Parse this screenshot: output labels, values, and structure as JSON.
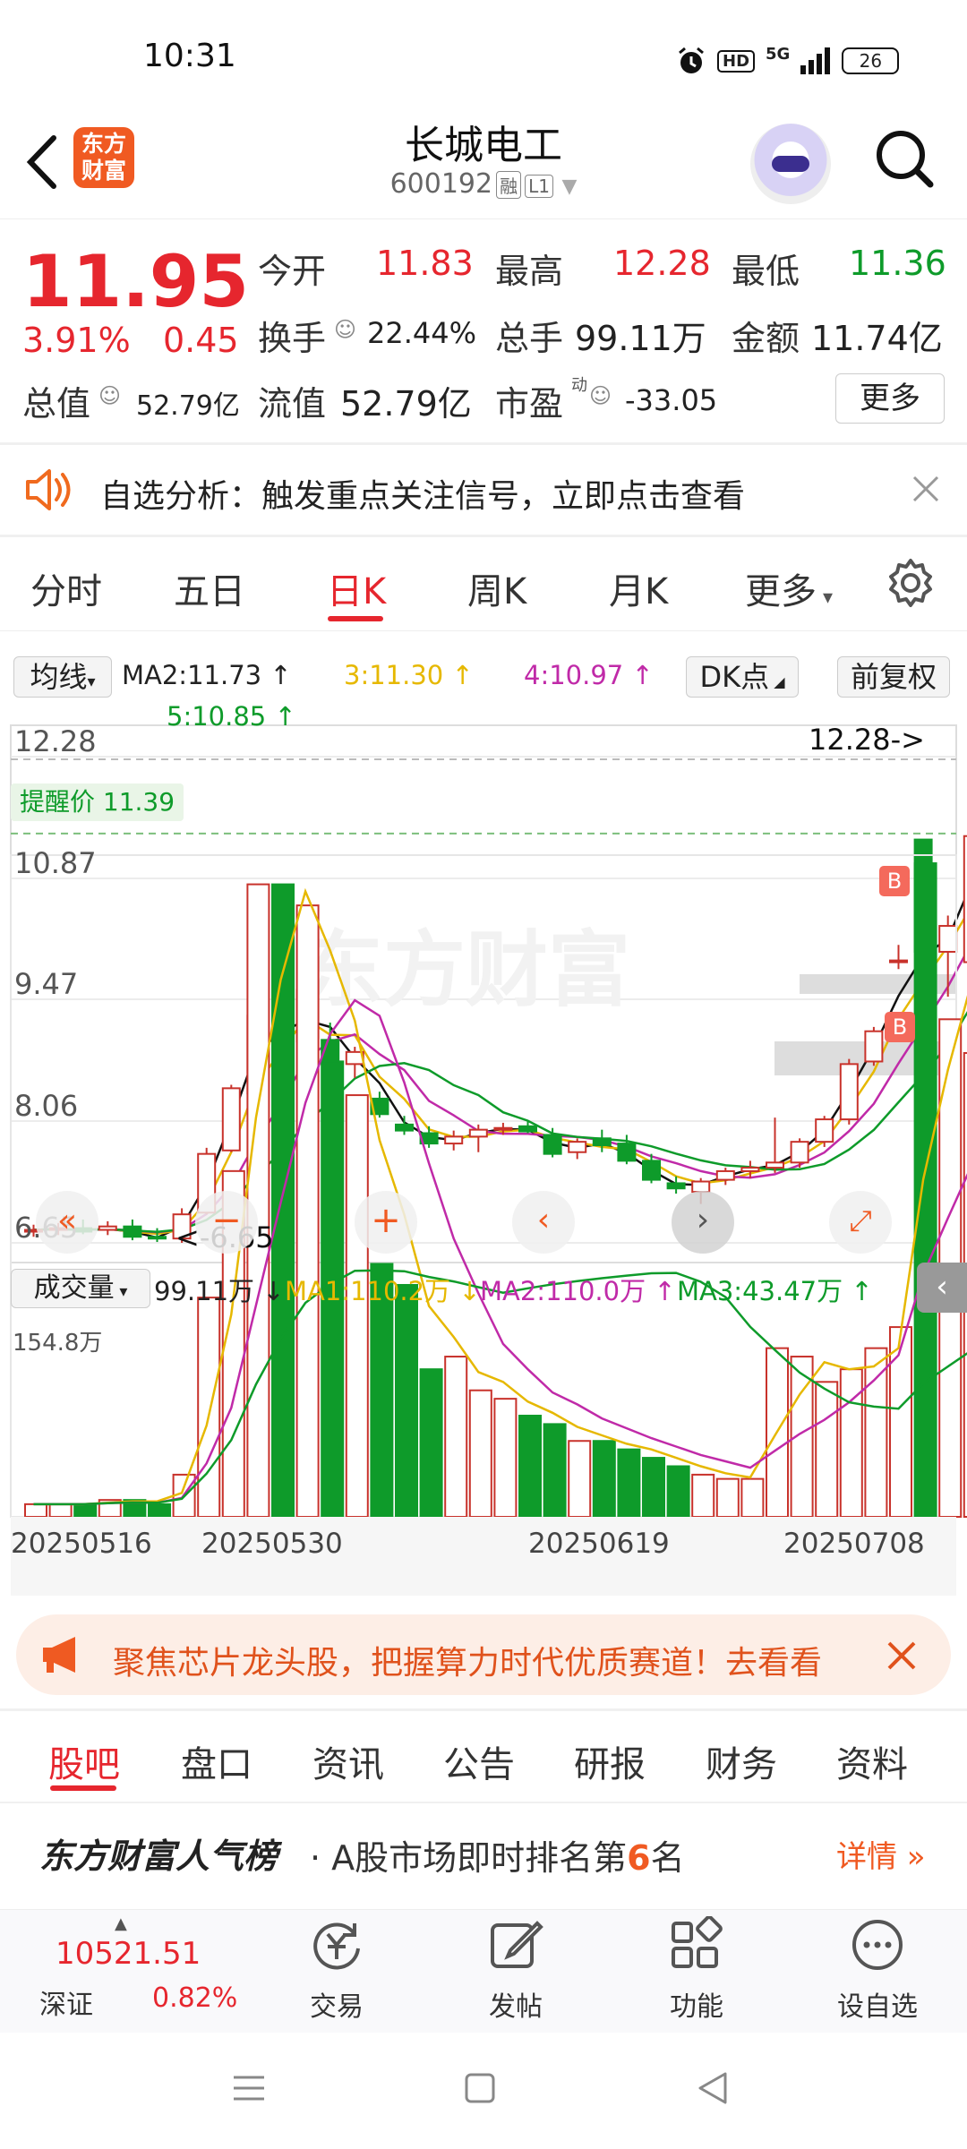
{
  "status": {
    "time": "10:31",
    "network": "5G",
    "hd": "HD",
    "battery": "26"
  },
  "header": {
    "logo_line1": "东方",
    "logo_line2": "财富",
    "title": "长城电工",
    "code": "600192",
    "tag1": "融",
    "tag2": "L1"
  },
  "quote": {
    "price": "11.95",
    "pct": "3.91%",
    "change": "0.45",
    "open_label": "今开",
    "open": "11.83",
    "high_label": "最高",
    "high": "12.28",
    "low_label": "最低",
    "low": "11.36",
    "turnover_label": "换手",
    "turnover": "22.44%",
    "volume_label": "总手",
    "volume": "99.11万",
    "amount_label": "金额",
    "amount": "11.74亿",
    "mktcap_label": "总值",
    "mktcap": "52.79亿",
    "float_label": "流值",
    "float": "52.79亿",
    "pe_label": "市盈",
    "pe_sup": "动",
    "pe": "-33.05",
    "more": "更多"
  },
  "alert": {
    "text": "自选分析：触发重点关注信号，立即点击查看"
  },
  "tabs": [
    "分时",
    "五日",
    "日K",
    "周K",
    "月K",
    "更多"
  ],
  "active_tab": "日K",
  "chart_controls": {
    "ma_select": "均线",
    "ma2": "MA2:11.73",
    "ma3": "3:11.30",
    "ma4": "4:10.97",
    "ma5": "5:10.85",
    "dk": "DK点",
    "adjust": "前复权",
    "reminder": "提醒价 11.39",
    "high_marker": "12.28->",
    "low_marker": "<-6.65",
    "vol_select": "成交量",
    "vol_value": "99.11万",
    "vol_ma1": "MA1:110.2万",
    "vol_ma2": "MA2:110.0万",
    "vol_ma3": "MA3:43.47万",
    "vol_max": "154.8万",
    "watermark": "东方财富",
    "buy_mark": "B"
  },
  "chart_data": {
    "type": "candlestick",
    "price_axis_ticks": [
      "12.28",
      "10.87",
      "9.47",
      "8.06",
      "6.65"
    ],
    "ylim": [
      6.65,
      12.28
    ],
    "x_tick_labels": [
      "20250516",
      "20250530",
      "20250619",
      "20250708"
    ],
    "reminder_price": 11.39,
    "candles": [
      {
        "o": 6.78,
        "h": 6.86,
        "l": 6.72,
        "c": 6.8
      },
      {
        "o": 6.8,
        "h": 6.88,
        "l": 6.74,
        "c": 6.82
      },
      {
        "o": 6.82,
        "h": 6.92,
        "l": 6.75,
        "c": 6.78
      },
      {
        "o": 6.8,
        "h": 6.9,
        "l": 6.74,
        "c": 6.84
      },
      {
        "o": 6.84,
        "h": 6.92,
        "l": 6.68,
        "c": 6.72
      },
      {
        "o": 6.72,
        "h": 6.82,
        "l": 6.66,
        "c": 6.7
      },
      {
        "o": 6.7,
        "h": 7.05,
        "l": 6.65,
        "c": 6.98
      },
      {
        "o": 7.0,
        "h": 7.75,
        "l": 6.98,
        "c": 7.68
      },
      {
        "o": 7.72,
        "h": 8.48,
        "l": 7.7,
        "c": 8.44
      },
      {
        "o": 8.38,
        "h": 9.3,
        "l": 8.18,
        "c": 9.28
      },
      {
        "o": 9.3,
        "h": 9.5,
        "l": 8.85,
        "c": 8.88
      },
      {
        "o": 8.98,
        "h": 9.7,
        "l": 8.88,
        "c": 9.58
      },
      {
        "o": 9.0,
        "h": 9.2,
        "l": 8.6,
        "c": 8.72
      },
      {
        "o": 8.72,
        "h": 8.92,
        "l": 8.56,
        "c": 8.86
      },
      {
        "o": 8.32,
        "h": 8.4,
        "l": 8.1,
        "c": 8.14
      },
      {
        "o": 8.02,
        "h": 8.12,
        "l": 7.9,
        "c": 7.95
      },
      {
        "o": 7.92,
        "h": 8.0,
        "l": 7.75,
        "c": 7.8
      },
      {
        "o": 7.8,
        "h": 7.95,
        "l": 7.72,
        "c": 7.88
      },
      {
        "o": 7.88,
        "h": 8.02,
        "l": 7.7,
        "c": 7.96
      },
      {
        "o": 7.96,
        "h": 8.04,
        "l": 7.9,
        "c": 7.98
      },
      {
        "o": 8.0,
        "h": 8.06,
        "l": 7.92,
        "c": 7.94
      },
      {
        "o": 7.9,
        "h": 7.98,
        "l": 7.64,
        "c": 7.68
      },
      {
        "o": 7.7,
        "h": 7.86,
        "l": 7.62,
        "c": 7.82
      },
      {
        "o": 7.86,
        "h": 7.96,
        "l": 7.7,
        "c": 7.78
      },
      {
        "o": 7.8,
        "h": 7.9,
        "l": 7.56,
        "c": 7.6
      },
      {
        "o": 7.6,
        "h": 7.68,
        "l": 7.34,
        "c": 7.38
      },
      {
        "o": 7.34,
        "h": 7.42,
        "l": 7.22,
        "c": 7.28
      },
      {
        "o": 7.24,
        "h": 7.4,
        "l": 7.1,
        "c": 7.36
      },
      {
        "o": 7.38,
        "h": 7.52,
        "l": 7.32,
        "c": 7.48
      },
      {
        "o": 7.48,
        "h": 7.6,
        "l": 7.4,
        "c": 7.52
      },
      {
        "o": 7.52,
        "h": 8.1,
        "l": 7.46,
        "c": 7.58
      },
      {
        "o": 7.58,
        "h": 7.86,
        "l": 7.52,
        "c": 7.82
      },
      {
        "o": 7.82,
        "h": 8.12,
        "l": 7.76,
        "c": 8.08
      },
      {
        "o": 8.08,
        "h": 8.78,
        "l": 8.02,
        "c": 8.72
      },
      {
        "o": 8.75,
        "h": 9.15,
        "l": 8.7,
        "c": 9.1
      },
      {
        "o": 9.9,
        "h": 10.1,
        "l": 9.82,
        "c": 9.92
      },
      {
        "o": 11.32,
        "h": 11.32,
        "l": 10.0,
        "c": 10.02
      },
      {
        "o": 10.02,
        "h": 10.44,
        "l": 9.5,
        "c": 10.32
      },
      {
        "o": 9.9,
        "h": 11.36,
        "l": 9.8,
        "c": 11.36
      },
      {
        "o": 11.83,
        "h": 12.28,
        "l": 11.36,
        "c": 11.95
      }
    ],
    "volume_ylim": [
      0,
      154.8
    ],
    "volume": [
      3,
      3,
      3,
      4,
      4,
      3,
      10,
      52,
      82,
      150,
      150,
      145,
      108,
      100,
      60,
      55,
      35,
      38,
      30,
      28,
      24,
      22,
      18,
      18,
      16,
      14,
      12,
      10,
      9,
      9,
      40,
      38,
      32,
      35,
      40,
      45,
      155,
      118,
      110,
      100
    ]
  },
  "promo": {
    "text": "聚焦芯片龙头股，把握算力时代优质赛道！去看看"
  },
  "section_tabs": [
    "股吧",
    "盘口",
    "资讯",
    "公告",
    "研报",
    "财务",
    "资料"
  ],
  "ranking": {
    "brand": "东方财富人气榜",
    "text_pre": "· A股市场即时排名第",
    "rank": "6",
    "text_post": "名",
    "detail": "详情"
  },
  "bottom": {
    "index_value": "10521.51",
    "index_name": "深证",
    "index_pct": "0.82%",
    "trade": "交易",
    "post": "发帖",
    "functions": "功能",
    "add_watch": "设自选"
  }
}
